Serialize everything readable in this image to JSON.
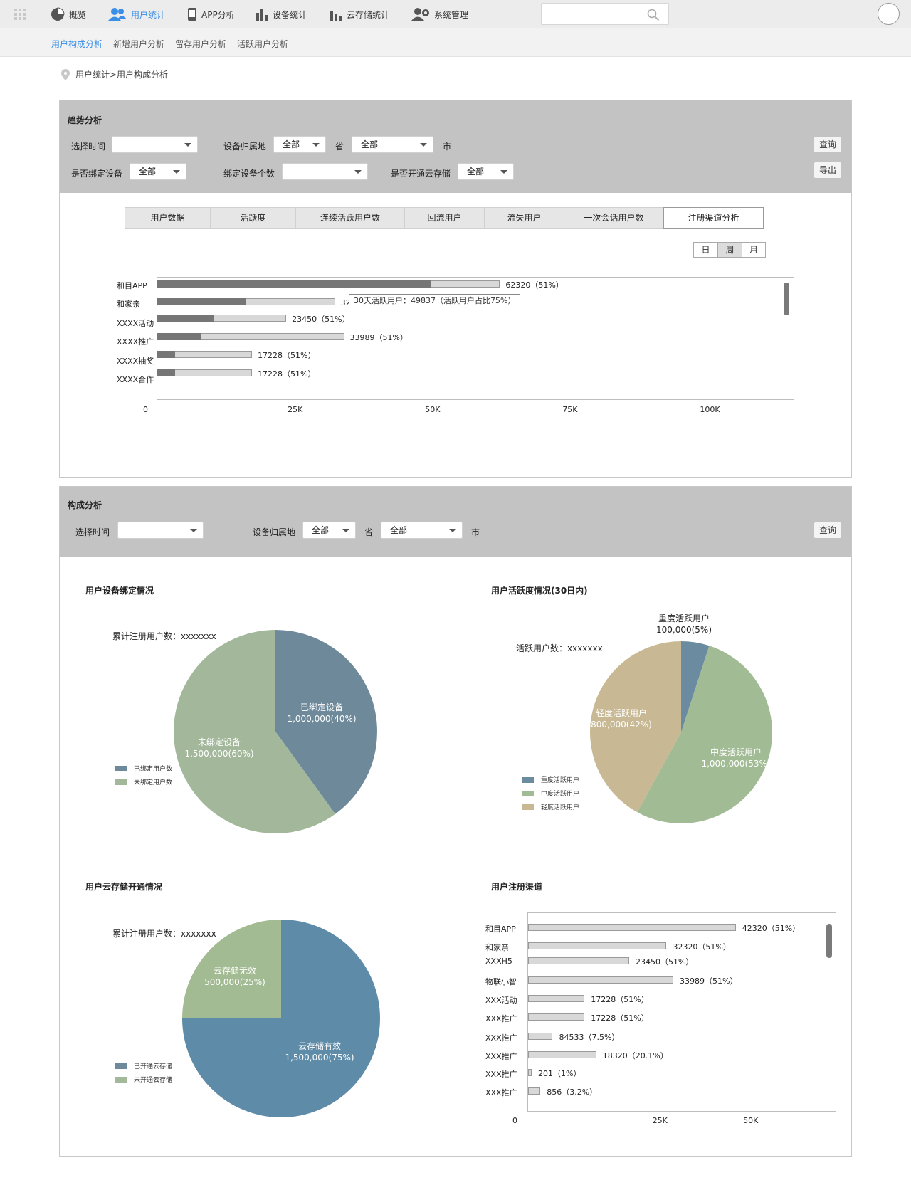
{
  "nav": {
    "items": [
      {
        "label": "概览"
      },
      {
        "label": "用户统计"
      },
      {
        "label": "APP分析"
      },
      {
        "label": "设备统计"
      },
      {
        "label": "云存储统计"
      },
      {
        "label": "系统管理"
      }
    ],
    "active_index": 1,
    "accent_color": "#3a8ee6"
  },
  "subnav": {
    "items": [
      {
        "label": "用户构成分析"
      },
      {
        "label": "新增用户分析"
      },
      {
        "label": "留存用户分析"
      },
      {
        "label": "活跃用户分析"
      }
    ],
    "active_index": 0
  },
  "breadcrumb": "用户统计>用户构成分析",
  "trend": {
    "title": "趋势分析",
    "filters": {
      "time_label": "选择时间",
      "time_value": "",
      "region_label": "设备归属地",
      "province_value": "全部",
      "province_suffix": "省",
      "city_value": "全部",
      "city_suffix": "市",
      "bound_label": "是否绑定设备",
      "bound_value": "全部",
      "count_label": "绑定设备个数",
      "count_value": "",
      "cloud_label": "是否开通云存储",
      "cloud_value": "全部"
    },
    "query_button": "查询",
    "export_button": "导出",
    "tabs": [
      "用户数据",
      "活跃度",
      "连续活跃用户数",
      "回流用户",
      "流失用户",
      "一次会话用户数",
      "注册渠道分析"
    ],
    "active_tab": 6,
    "period": [
      "日",
      "周",
      "月"
    ],
    "active_period": 1,
    "tooltip": "30天活跃用户：49837（活跃用户占比75%）"
  },
  "composition": {
    "title": "构成分析",
    "filters": {
      "time_label": "选择时间",
      "time_value": "",
      "region_label": "设备归属地",
      "province_value": "全部",
      "province_suffix": "省",
      "city_value": "全部",
      "city_suffix": "市"
    },
    "query_button": "查询",
    "binding": {
      "title": "用户设备绑定情况",
      "total": "累计注册用户数：xxxxxxx",
      "slices": [
        {
          "name": "已绑定设备",
          "value": "1,000,000(40%)",
          "color": "#6e8a9a"
        },
        {
          "name": "未绑定设备",
          "value": "1,500,000(60%)",
          "color": "#a3b89b"
        }
      ],
      "legend": [
        "已绑定用户数",
        "未绑定用户数"
      ]
    },
    "activity": {
      "title": "用户活跃度情况(30日内)",
      "total": "活跃用户数：xxxxxxx",
      "slices": [
        {
          "name": "重度活跃用户",
          "value": "100,000(5%)",
          "color": "#6b8ca0"
        },
        {
          "name": "中度活跃用户",
          "value": "1,000,000(53%)",
          "color": "#a1bb94"
        },
        {
          "name": "轻度活跃用户",
          "value": "800,000(42%)",
          "color": "#c8b994"
        }
      ],
      "legend": [
        "重度活跃用户",
        "中度活跃用户",
        "轻度活跃用户"
      ]
    },
    "cloud": {
      "title": "用户云存储开通情况",
      "total": "累计注册用户数：xxxxxxx",
      "slices": [
        {
          "name": "云存储有效",
          "value": "1,500,000(75%)",
          "color": "#5e8ba8"
        },
        {
          "name": "云存储无效",
          "value": "500,000(25%)",
          "color": "#a3bb93"
        }
      ],
      "legend": [
        "已开通云存储",
        "未开通云存储"
      ]
    },
    "channel_title": "用户注册渠道"
  },
  "chart_data": [
    {
      "type": "bar",
      "orientation": "horizontal",
      "categories": [
        "和目APP",
        "和家亲",
        "XXXX活动",
        "XXXX推广",
        "XXXX抽奖",
        "XXXX合作"
      ],
      "series": [
        {
          "values": [
            49837,
            16000,
            10300,
            8000,
            3200,
            3200
          ]
        },
        {
          "values": [
            62320,
            32320,
            23450,
            33989,
            17228,
            17228
          ]
        }
      ],
      "value_labels": [
        "62320（51%）",
        "32320（51%）",
        "23450（51%）",
        "33989（51%）",
        "17228（51%）",
        "17228（51%）"
      ],
      "xticks": [
        "0",
        "25K",
        "50K",
        "75K",
        "100K"
      ],
      "xlim": [
        0,
        116000
      ],
      "colors": [
        "#767676",
        "#d8d8d8"
      ]
    },
    {
      "type": "pie",
      "title": "用户设备绑定情况",
      "labels": [
        "已绑定设备",
        "未绑定设备"
      ],
      "values": [
        40,
        60
      ]
    },
    {
      "type": "pie",
      "title": "用户活跃度情况(30日内)",
      "labels": [
        "重度活跃用户",
        "中度活跃用户",
        "轻度活跃用户"
      ],
      "values": [
        5,
        53,
        42
      ]
    },
    {
      "type": "pie",
      "title": "用户云存储开通情况",
      "labels": [
        "云存储有效",
        "云存储无效"
      ],
      "values": [
        75,
        25
      ]
    },
    {
      "type": "bar",
      "orientation": "horizontal",
      "title": "用户注册渠道",
      "categories": [
        "和目APP",
        "和家亲",
        "XXXH5",
        "物联小智",
        "XXX活动",
        "XXX推广",
        "XXX推广",
        "XXX推广",
        "XXX推广",
        "XXX推广"
      ],
      "values": [
        42320,
        32320,
        23450,
        33989,
        17228,
        17228,
        84533,
        18320,
        201,
        856
      ],
      "value_labels": [
        "42320（51%）",
        "32320（51%）",
        "23450（51%）",
        "33989（51%）",
        "17228（51%）",
        "17228（51%）",
        "84533（7.5%）",
        "18320（20.1%）",
        "201（1%）",
        "856（3.2%）"
      ],
      "bar_widths_in_units": [
        42320,
        28200,
        20600,
        29600,
        11500,
        11500,
        5000,
        13900,
        700,
        2500
      ],
      "xticks": [
        "0",
        "25K",
        "50K"
      ],
      "xlim": [
        0,
        56000
      ],
      "colors": [
        "#d8d8d8"
      ]
    }
  ]
}
